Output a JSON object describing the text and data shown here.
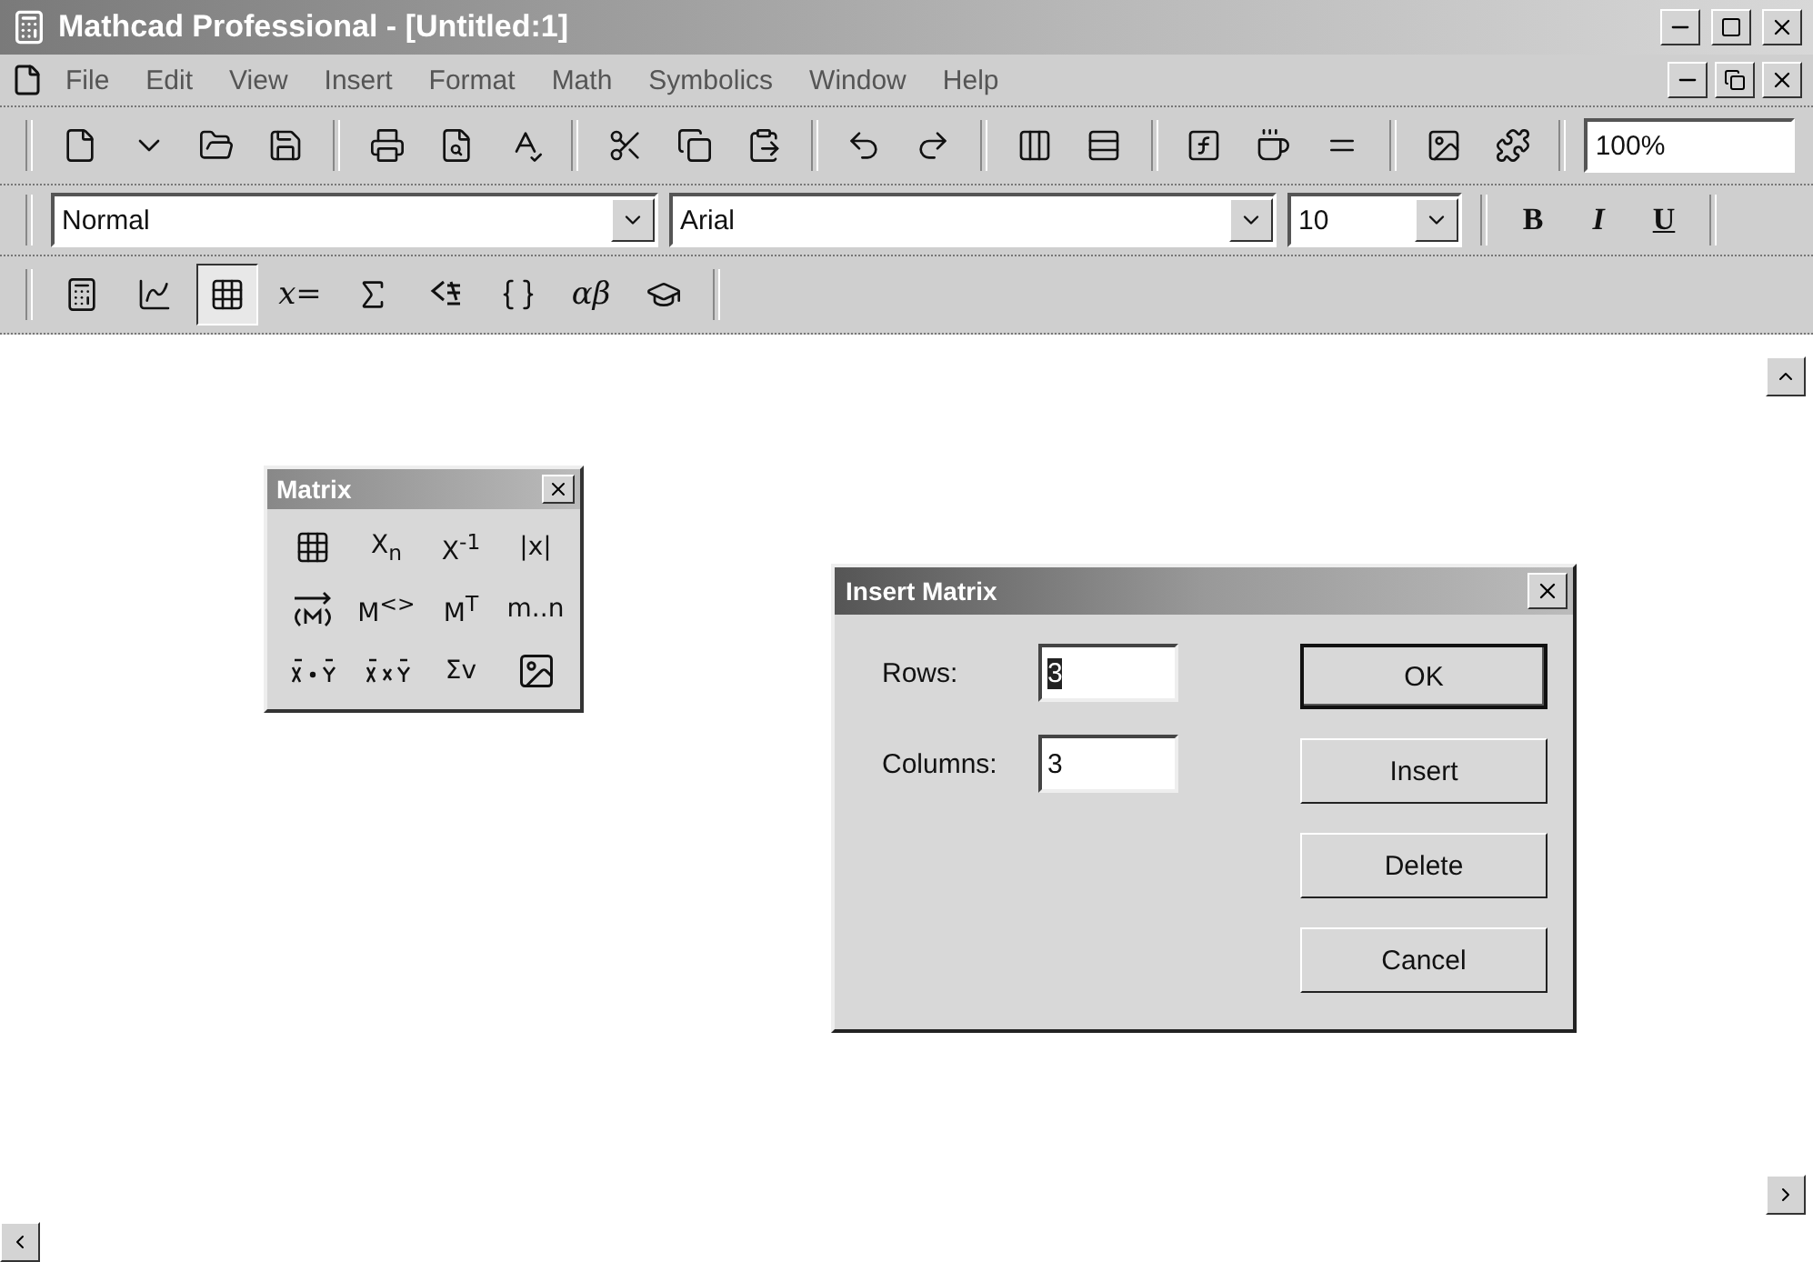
{
  "window": {
    "title": "Mathcad Professional - [Untitled:1]"
  },
  "menu": [
    {
      "label": "File"
    },
    {
      "label": "Edit"
    },
    {
      "label": "View"
    },
    {
      "label": "Insert"
    },
    {
      "label": "Format"
    },
    {
      "label": "Math"
    },
    {
      "label": "Symbolics"
    },
    {
      "label": "Window"
    },
    {
      "label": "Help"
    }
  ],
  "zoom": {
    "value": "100%"
  },
  "format_bar": {
    "style": "Normal",
    "font": "Arial",
    "size": "10",
    "buttons": [
      {
        "label": "B",
        "kind": "bold"
      },
      {
        "label": "I",
        "kind": "italic"
      },
      {
        "label": "U",
        "kind": "underline"
      }
    ]
  },
  "math_toolbar": [
    {
      "kind": "calculator",
      "selected": false
    },
    {
      "kind": "graph",
      "selected": false
    },
    {
      "kind": "matrix",
      "selected": true
    },
    {
      "kind": "text",
      "label": "x=",
      "selected": false
    },
    {
      "kind": "calculus",
      "selected": false
    },
    {
      "kind": "boolean",
      "selected": false
    },
    {
      "kind": "programming",
      "selected": false
    },
    {
      "kind": "text",
      "label": "αβ",
      "selected": false
    },
    {
      "kind": "symbolic",
      "selected": false
    }
  ],
  "matrix_palette": {
    "title": "Matrix",
    "items": [
      {
        "kind": "matrix"
      },
      {
        "kind": "text",
        "label": "X$_{n}$"
      },
      {
        "kind": "text",
        "label": "X$^{-1}$"
      },
      {
        "kind": "text",
        "label": "|x|"
      },
      {
        "kind": "vectorize"
      },
      {
        "kind": "text",
        "label": "M$^{<>}$"
      },
      {
        "kind": "text",
        "label": "M$^{T}$"
      },
      {
        "kind": "text",
        "label": "m..n"
      },
      {
        "kind": "dot"
      },
      {
        "kind": "cross"
      },
      {
        "kind": "text",
        "label": "Σv"
      },
      {
        "kind": "picture"
      }
    ]
  },
  "dialog": {
    "title": "Insert Matrix",
    "fields": [
      {
        "label": "Rows:",
        "value": "3",
        "selected": true
      },
      {
        "label": "Columns:",
        "value": "3",
        "selected": false
      }
    ],
    "buttons": [
      {
        "label": "OK",
        "default": true
      },
      {
        "label": "Insert",
        "default": false
      },
      {
        "label": "Delete",
        "default": false
      },
      {
        "label": "Cancel",
        "default": false
      }
    ]
  }
}
